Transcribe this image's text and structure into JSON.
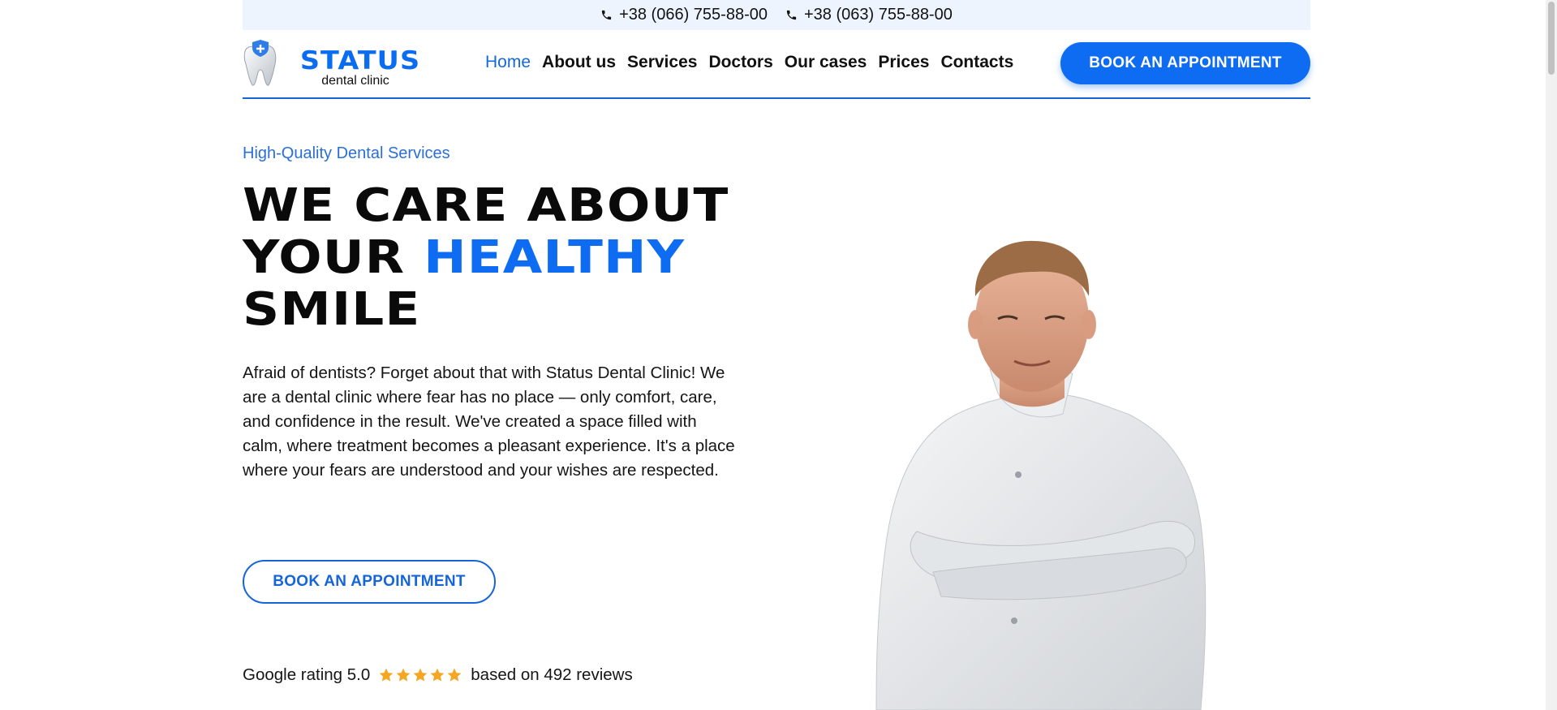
{
  "topbar": {
    "phones": [
      "+38 (066) 755-88-00",
      "+38 (063) 755-88-00"
    ]
  },
  "logo": {
    "name": "STATUS",
    "subtitle": "dental clinic"
  },
  "nav": {
    "items": [
      "Home",
      "About us",
      "Services",
      "Doctors",
      "Our cases",
      "Prices",
      "Contacts"
    ],
    "active": "Home"
  },
  "header": {
    "cta_label": "BOOK AN APPOINTMENT"
  },
  "hero": {
    "kicker": "High-Quality Dental Services",
    "headline_line1": "WE CARE ABOUT",
    "headline_line2_start": "YOUR ",
    "headline_line2_accent": "HEALTHY",
    "headline_line3": "SMILE",
    "description": "Afraid of dentists? Forget about that with Status Dental Clinic! We are a dental clinic where fear has no place — only comfort, care, and confidence in the result. We've created a space filled with calm, where treatment becomes a pleasant experience. It's a place where your fears are understood and your wishes are respected.",
    "cta_label": "BOOK AN APPOINTMENT"
  },
  "rating": {
    "label": "Google rating 5.0",
    "stars": 5,
    "reviews_text": "based on 492 reviews"
  },
  "colors": {
    "accent": "#0d6cf2",
    "accent_dark": "#1565d8",
    "topbar_bg": "#eef4fd",
    "star": "#f5a623"
  },
  "icons": {
    "phone": "phone-icon",
    "star": "star-icon",
    "logo": "tooth-shield-icon"
  }
}
